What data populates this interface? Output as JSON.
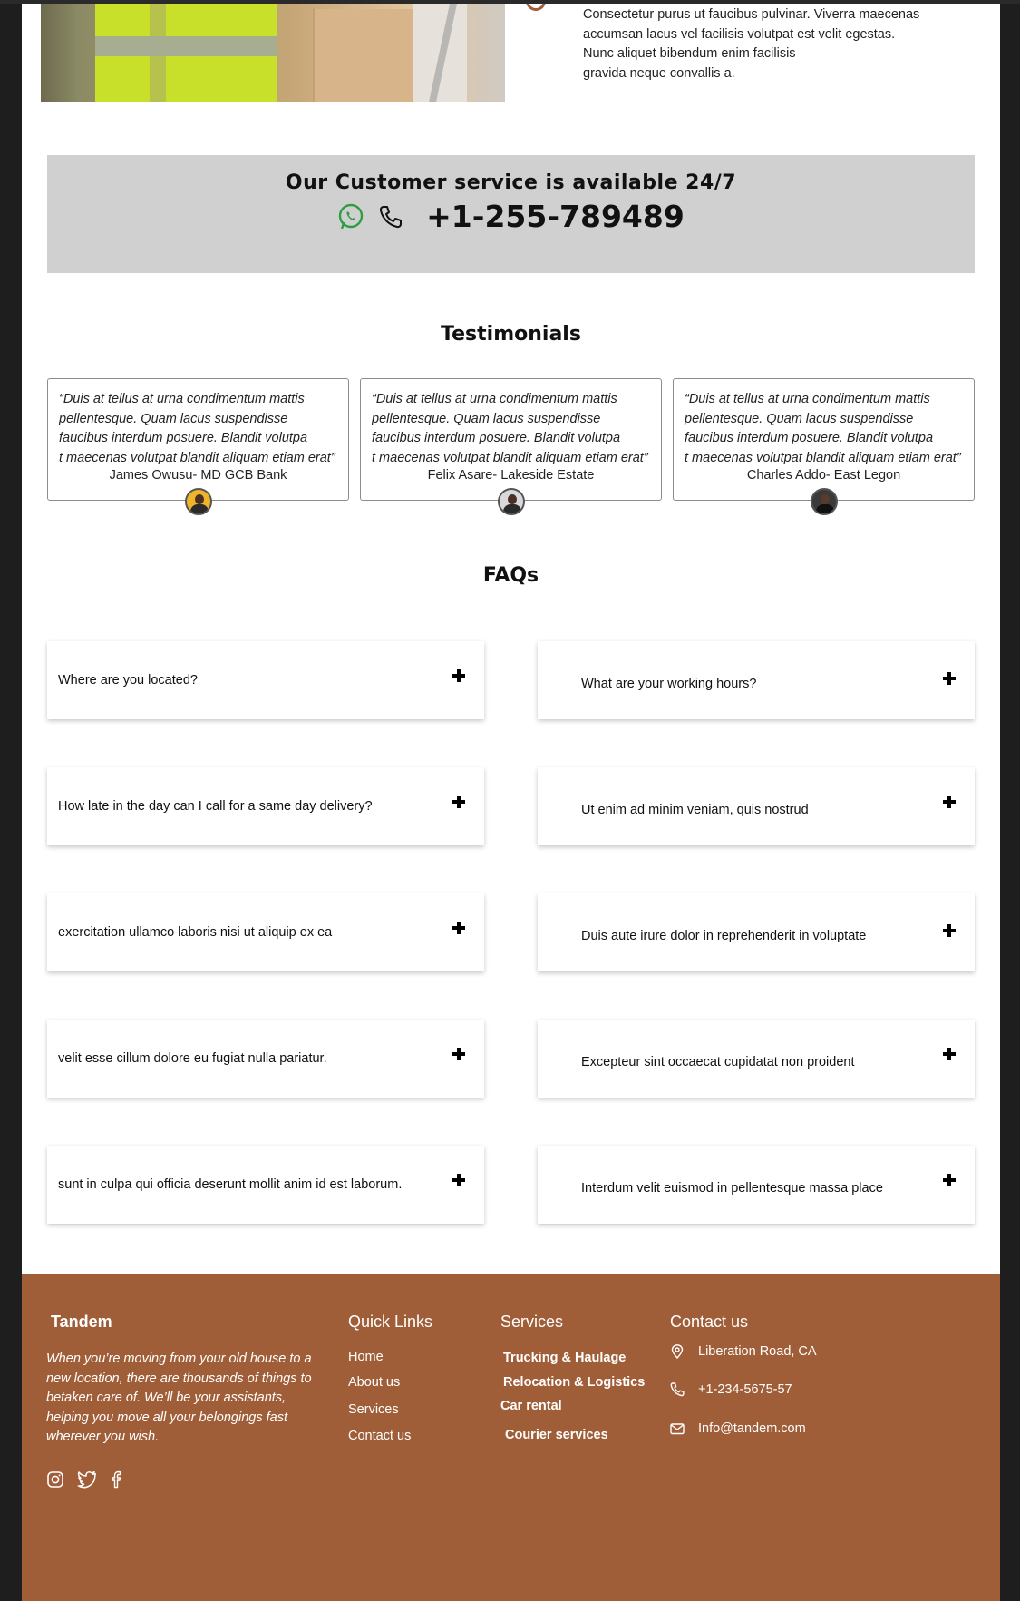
{
  "hero": {
    "lines": [
      "Consectetur purus ut faucibus pulvinar. Viverra maecenas",
      "accumsan lacus vel facilisis volutpat est velit egestas.",
      "Nunc aliquet bibendum enim facilisis",
      "gravida neque convallis a."
    ]
  },
  "customer_service": {
    "title": "Our Customer service is available 24/7",
    "phone": "+1-255-789489",
    "icons": [
      "whatsapp-icon",
      "phone-icon"
    ]
  },
  "testimonials": {
    "title": "Testimonials",
    "items": [
      {
        "quote_lines": [
          "“Duis at tellus at urna condimentum mattis",
          "pellentesque. Quam lacus suspendisse",
          "faucibus interdum posuere. Blandit volutpa",
          "t maecenas volutpat blandit aliquam etiam erat”"
        ],
        "author": "James Owusu- MD GCB Bank",
        "avatar_color": "#f0b429"
      },
      {
        "quote_lines": [
          "“Duis at tellus at urna condimentum mattis",
          "pellentesque. Quam lacus suspendisse",
          "faucibus interdum posuere. Blandit volutpa",
          "t maecenas volutpat blandit aliquam etiam erat”"
        ],
        "author": "Felix Asare-  Lakeside Estate",
        "avatar_color": "#d9d9d9"
      },
      {
        "quote_lines": [
          "“Duis at tellus at urna condimentum mattis",
          "pellentesque. Quam lacus suspendisse",
          "faucibus interdum posuere. Blandit volutpa",
          "t maecenas volutpat blandit aliquam etiam erat”"
        ],
        "author": "Charles Addo- East Legon",
        "avatar_color": "#3a3a3a"
      }
    ]
  },
  "faqs": {
    "title": "FAQs",
    "left": [
      "Where are you located?",
      "How late in the day can I call for a same day delivery?",
      "exercitation ullamco laboris nisi ut aliquip ex ea",
      "velit esse cillum dolore eu fugiat nulla pariatur.",
      "sunt in culpa qui officia deserunt mollit anim id est laborum."
    ],
    "right": [
      "What are your working hours?",
      "Ut enim ad minim veniam, quis nostrud",
      "Duis aute irure dolor in reprehenderit in voluptate",
      "Excepteur sint occaecat cupidatat non proident",
      "Interdum velit euismod in pellentesque massa place"
    ]
  },
  "footer": {
    "brand": "Tandem",
    "description": "When you’re moving from your old house to a new location, there are thousands of things to betaken care of. We’ll be your assistants, helping you move all your belongings fast wherever you wish.",
    "social_icons": [
      "instagram-icon",
      "twitter-icon",
      "facebook-icon"
    ],
    "quick_links": {
      "title": "Quick Links",
      "items": [
        "Home",
        "About us",
        "Services",
        "Contact us"
      ]
    },
    "services": {
      "title": "Services",
      "items": [
        "Trucking & Haulage",
        "Relocation & Logistics",
        "Car rental",
        "Courier services"
      ]
    },
    "contact": {
      "title": "Contact us",
      "address": "Liberation Road, CA",
      "phone": "+1-234-5675-57",
      "email": "Info@tandem.com"
    },
    "background": "#a05e38"
  },
  "colors": {
    "accent": "#a05e38",
    "banner": "#d0d0d0",
    "whatsapp": "#2e9e43"
  }
}
